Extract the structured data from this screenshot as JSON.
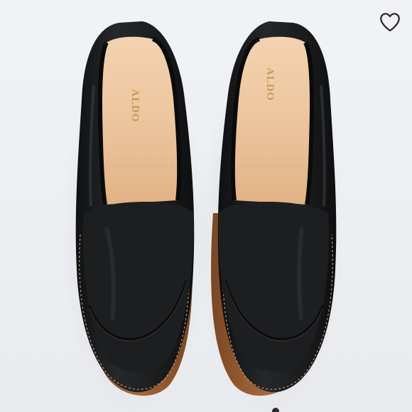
{
  "product": {
    "brand_stamp": "ALDO",
    "shoe_color": "#1a1b1c",
    "lining_color": "#e9c29c",
    "sole_color": "#9a5f35"
  },
  "like_button": {
    "icon": "heart-outline-icon",
    "label": "Like"
  },
  "carousel": {
    "current": 1
  }
}
